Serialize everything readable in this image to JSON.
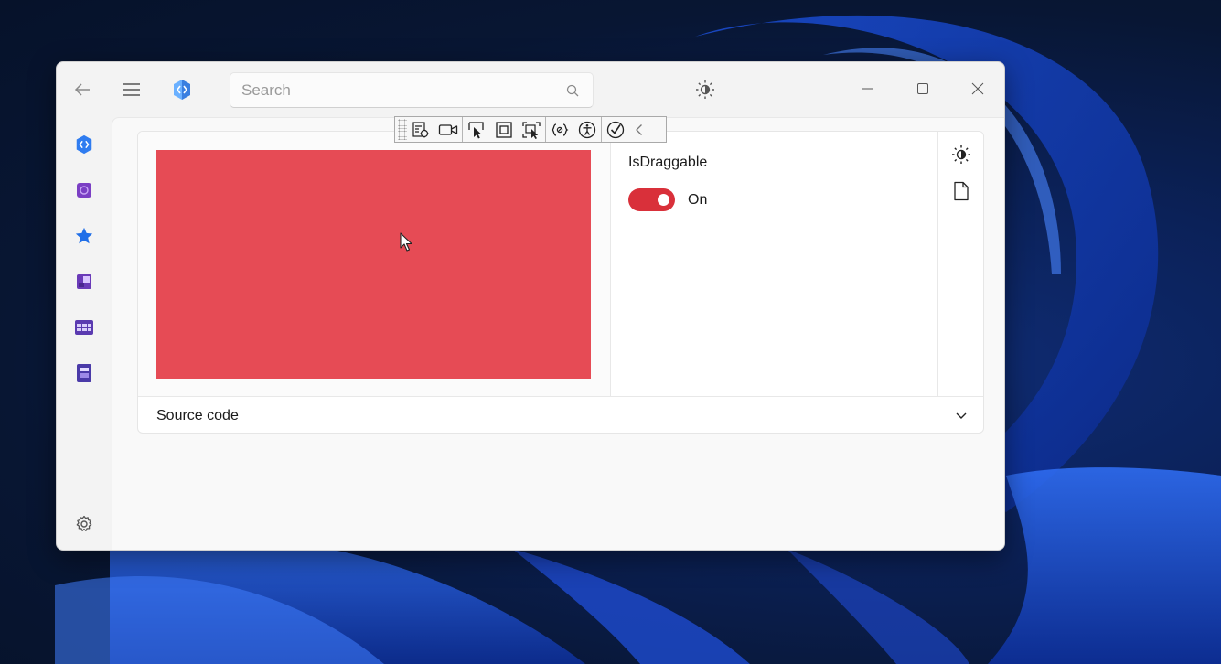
{
  "search": {
    "placeholder": "Search"
  },
  "nav": {
    "items": [
      {
        "icon": "home-icon"
      },
      {
        "icon": "puzzle-icon"
      },
      {
        "icon": "star-icon"
      },
      {
        "icon": "controls-icon"
      },
      {
        "icon": "grid-icon"
      },
      {
        "icon": "layout-icon"
      }
    ],
    "settings_icon": "gear-icon"
  },
  "sample": {
    "option_label": "IsDraggable",
    "toggle_state": "On",
    "source_label": "Source code",
    "rect_color": "#e64b55"
  },
  "colors": {
    "accent": "#d9303a",
    "window_bg": "#f3f3f3"
  }
}
